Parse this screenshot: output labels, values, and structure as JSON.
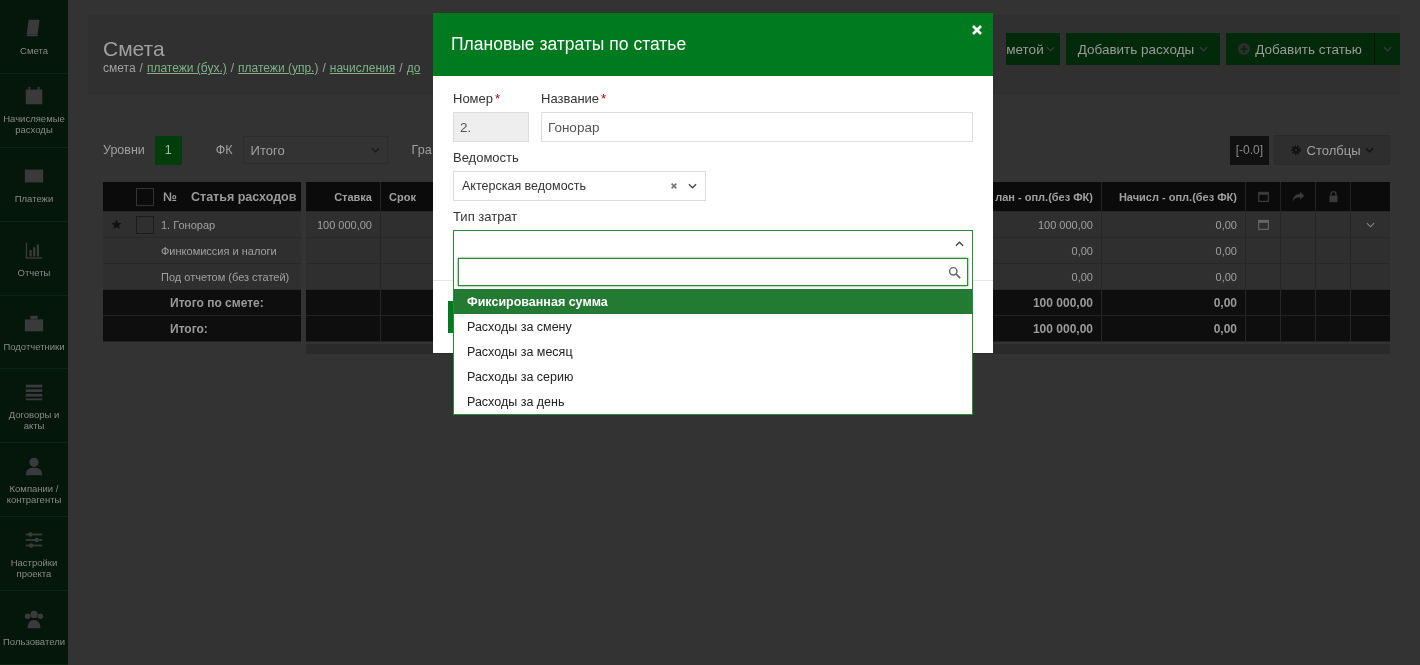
{
  "sidebar": {
    "items": [
      {
        "label": "Смета"
      },
      {
        "label": "Начисляемые расходы"
      },
      {
        "label": "Платежи"
      },
      {
        "label": "Отчеты"
      },
      {
        "label": "Подотчетники"
      },
      {
        "label": "Договоры и акты"
      },
      {
        "label": "Компании / контрагенты"
      },
      {
        "label": "Настройки проекта"
      },
      {
        "label": "Пользователи"
      }
    ]
  },
  "header": {
    "title": "Смета",
    "separator": "/",
    "breadcrumb": [
      {
        "text": "смета",
        "link": false
      },
      {
        "text": "платежи (бух.)",
        "link": true
      },
      {
        "text": "платежи (упр.)",
        "link": true
      },
      {
        "text": "начисления",
        "link": true
      },
      {
        "text": "до",
        "link": true
      }
    ]
  },
  "actions": [
    {
      "label": "метой",
      "kind": "dropdown"
    },
    {
      "label": "Добавить расходы",
      "kind": "dropdown"
    },
    {
      "label": "Добавить статью",
      "kind": "split"
    }
  ],
  "toolbar": {
    "levels_label": "Уровни",
    "levels_value": "1",
    "fk_label": "ФК",
    "fk_value": "Итого",
    "group_label": "Гра",
    "badge": "[-0.0]",
    "columns_button": "Столбцы"
  },
  "table": {
    "left_columns": [
      "№",
      "Статья расходов"
    ],
    "header_checked": false,
    "right_columns": [
      "Ставка",
      "Срок",
      "лан - опл.(без ФК)",
      "Начисл - опл.(без ФК)"
    ],
    "rows": [
      {
        "kind": "item",
        "starred": true,
        "checked": false,
        "name": "1. Гонорар",
        "cells": [
          "100 000,00",
          null,
          "100 000,00",
          "0,00"
        ],
        "has_date": true,
        "expandable": true
      },
      {
        "kind": "sub",
        "name": "Финкомиссия и налоги",
        "cells": [
          null,
          null,
          "0,00",
          "0,00"
        ]
      },
      {
        "kind": "sub",
        "name": "Под отчетом (без статей)",
        "cells": [
          null,
          null,
          "0,00",
          "0,00"
        ]
      },
      {
        "kind": "total",
        "name": "Итого по смете:",
        "cells": [
          null,
          null,
          "100 000,00",
          "0,00"
        ]
      },
      {
        "kind": "total",
        "name": "Итого:",
        "cells": [
          null,
          null,
          "100 000,00",
          "0,00"
        ]
      }
    ]
  },
  "modal": {
    "title": "Плановые затраты по статье",
    "number": {
      "label": "Номер",
      "mark": "*",
      "value": "2.",
      "disabled": true
    },
    "name": {
      "label": "Название",
      "mark": "*",
      "value": "Гонорар"
    },
    "sheet": {
      "label": "Ведомость",
      "value": "Актерская ведомость",
      "clearable": true
    },
    "cost_type": {
      "label": "Тип затрат",
      "expanded": true,
      "options": [
        {
          "label": "Фиксированная сумма",
          "selected": true
        },
        {
          "label": "Расходы за смену",
          "selected": false
        },
        {
          "label": "Расходы за месяц",
          "selected": false
        },
        {
          "label": "Расходы за серию",
          "selected": false
        },
        {
          "label": "Расходы за день",
          "selected": false
        }
      ]
    }
  }
}
